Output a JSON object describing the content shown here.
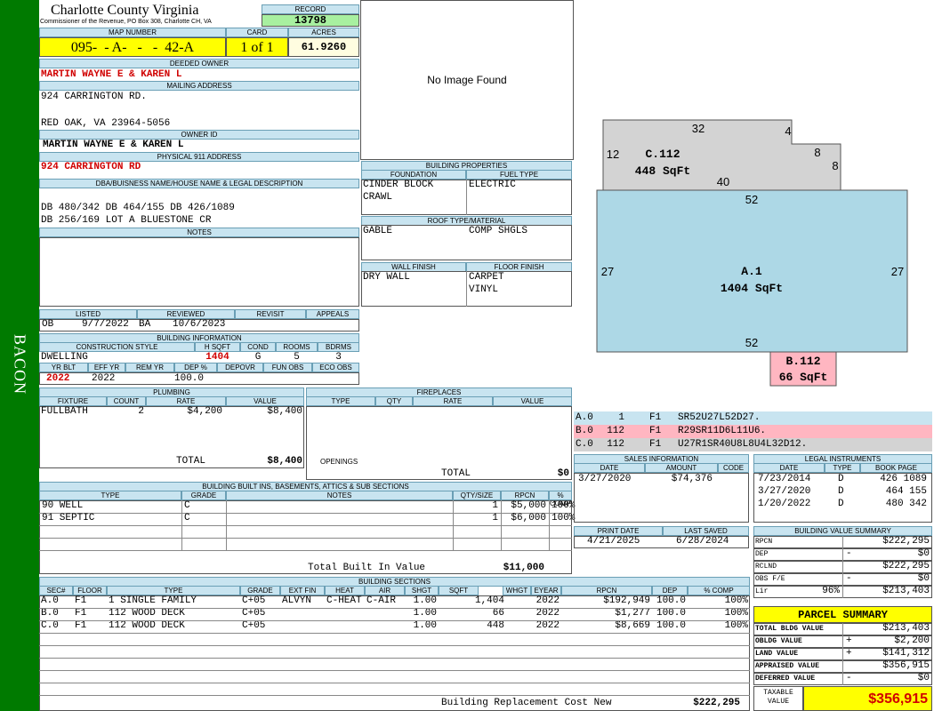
{
  "side": {
    "label": "BACON"
  },
  "header": {
    "county": "Charlotte County Virginia",
    "address": "Commissioner of the Revenue, PO Box 308, Charlotte CH, VA",
    "record_label": "RECORD",
    "record": "13798"
  },
  "map": {
    "label": "MAP NUMBER",
    "value": "095-  - A-   -   -  42-A",
    "card_label": "CARD",
    "card": "1 of 1",
    "acres_label": "ACRES",
    "acres": "61.9260"
  },
  "owner": {
    "deeded_label": "DEEDED OWNER",
    "deeded": "MARTIN WAYNE E & KAREN L",
    "mailing_label": "MAILING ADDRESS",
    "addr1": "924 CARRINGTON RD.",
    "addr2": "RED OAK, VA 23964-5056",
    "ownerid_label": "OWNER ID",
    "ownerid": "MARTIN WAYNE E & KAREN L",
    "phys_label": "PHYSICAL 911 ADDRESS",
    "phys": "924 CARRINGTON RD",
    "dba_label": "DBA/BUISNESS NAME/HOUSE NAME & LEGAL DESCRIPTION",
    "legal1": "DB 480/342 DB 464/155 DB 426/1089",
    "legal2": "DB 256/169 LOT A BLUESTONE CR",
    "notes_label": "NOTES"
  },
  "image": {
    "text": "No Image Found"
  },
  "building_props": {
    "label": "BUILDING PROPERTIES",
    "foundation_label": "FOUNDATION",
    "fuel_label": "FUEL TYPE",
    "foundation1": "CINDER BLOCK",
    "foundation2": "CRAWL",
    "fuel": "ELECTRIC",
    "roof_label": "ROOF TYPE/MATERIAL",
    "roof1": "GABLE",
    "roof2": "COMP SHGLS",
    "wall_label": "WALL FINISH",
    "floor_label": "FLOOR FINISH",
    "wall": "DRY WALL",
    "floor1": "CARPET",
    "floor2": "VINYL"
  },
  "listing": {
    "listed_label": "LISTED",
    "reviewed_label": "REVIEWED",
    "revisit_label": "REVISIT",
    "appeals_label": "APPEALS",
    "listed_by": "OB",
    "listed_date": "9/7/2022",
    "reviewed_by": "BA",
    "reviewed_date": "10/6/2023"
  },
  "building_info": {
    "label": "BUILDING INFORMATION",
    "cs_label": "CONSTRUCTION STYLE",
    "hsqft_label": "H SQFT",
    "cond_label": "COND",
    "rooms_label": "ROOMS",
    "bdrms_label": "BDRMS",
    "style": "DWELLING",
    "hsqft": "1404",
    "cond": "G",
    "rooms": "5",
    "bdrms": "3",
    "yrblt_label": "YR BLT",
    "effyr_label": "EFF YR",
    "remyr_label": "REM YR",
    "dep_label": "DEP %",
    "depovr_label": "DEPOVR",
    "funobs_label": "FUN OBS",
    "ecoobs_label": "ECO OBS",
    "yrblt": "2022",
    "effyr": "2022",
    "dep": "100.0"
  },
  "plumbing": {
    "label": "PLUMBING",
    "cols": [
      "FIXTURE",
      "COUNT",
      "RATE",
      "VALUE"
    ],
    "fixture": "FULLBATH",
    "count": "2",
    "rate": "$4,200",
    "value": "$8,400",
    "total_label": "TOTAL",
    "total": "$8,400"
  },
  "fireplaces": {
    "label": "FIREPLACES",
    "cols": [
      "TYPE",
      "QTY",
      "RATE",
      "VALUE"
    ],
    "openings_label": "OPENINGS",
    "total_label": "TOTAL",
    "total": "$0"
  },
  "builtins": {
    "label": "BUILDING BUILT INS, BASEMENTS, ATTICS & SUB SECTIONS",
    "cols": [
      "TYPE",
      "GRADE",
      "NOTES",
      "QTY/SIZE",
      "RPCN",
      "% COMP"
    ],
    "rows": [
      [
        "90 WELL",
        "C",
        "",
        "1",
        "$5,000",
        "100%"
      ],
      [
        "91 SEPTIC",
        "C",
        "",
        "1",
        "$6,000",
        "100%"
      ]
    ],
    "total_label": "Total Built In Value",
    "total": "$11,000"
  },
  "sections": {
    "label": "BUILDING SECTIONS",
    "cols": [
      "SEC#",
      "FLOOR",
      "TYPE",
      "GRADE",
      "EXT FIN",
      "HEAT",
      "AIR",
      "SHGT",
      "SQFT",
      "WHGT",
      "EYEAR",
      "RPCN",
      "DEP",
      "% COMP"
    ],
    "rows": [
      [
        "A.0",
        "F1",
        "1 SINGLE FAMILY",
        "C+05",
        "ALVYN",
        "C-HEAT",
        "C-AIR",
        "1.00",
        "1,404",
        "",
        "2022",
        "$192,949",
        "100.0",
        "100%"
      ],
      [
        "B.0",
        "F1",
        "112 WOOD DECK",
        "C+05",
        "",
        "",
        "",
        "1.00",
        "66",
        "",
        "2022",
        "$1,277",
        "100.0",
        "100%"
      ],
      [
        "C.0",
        "F1",
        "112 WOOD DECK",
        "C+05",
        "",
        "",
        "",
        "1.00",
        "448",
        "",
        "2022",
        "$8,669",
        "100.0",
        "100%"
      ]
    ],
    "rcn_label": "Building Replacement Cost New",
    "rcn": "$222,295"
  },
  "sketch": {
    "c_label": "C.112",
    "c_area": "448 SqFt",
    "a_label": "A.1",
    "a_area": "1404 SqFt",
    "b_label": "B.112",
    "b_area": "66 SqFt",
    "dims": {
      "c_top": "32",
      "c_notch": "4",
      "c_left": "12",
      "c_step": "8",
      "c_right": "8",
      "c_bottom": "40",
      "a_top": "52",
      "a_left": "27",
      "a_right": "27",
      "a_bottom": "52"
    }
  },
  "traverses": [
    {
      "sec": "A.0",
      "n": "1",
      "f": "F1",
      "path": "SR52U27L52D27."
    },
    {
      "sec": "B.0",
      "n": "112",
      "f": "F1",
      "path": "R29SR11D6L11U6."
    },
    {
      "sec": "C.0",
      "n": "112",
      "f": "F1",
      "path": "U27R1SR40U8L8U4L32D12."
    }
  ],
  "sales": {
    "label": "SALES INFORMATION",
    "cols": [
      "DATE",
      "AMOUNT",
      "CODE"
    ],
    "rows": [
      [
        "3/27/2020",
        "$74,376",
        ""
      ]
    ]
  },
  "legal": {
    "label": "LEGAL INSTRUMENTS",
    "cols": [
      "DATE",
      "TYPE",
      "BOOK PAGE"
    ],
    "rows": [
      [
        "7/23/2014",
        "D",
        "426 1089"
      ],
      [
        "3/27/2020",
        "D",
        "464 155"
      ],
      [
        "1/20/2022",
        "D",
        "480 342"
      ]
    ]
  },
  "dates": {
    "print_label": "PRINT DATE",
    "saved_label": "LAST SAVED",
    "print": "4/21/2025",
    "saved": "6/28/2024"
  },
  "bvs": {
    "label": "BUILDING VALUE SUMMARY",
    "rows": [
      [
        "RPCN",
        "",
        "",
        "$222,295"
      ],
      [
        "DEP",
        "",
        "-",
        "$0"
      ],
      [
        "RCLND",
        "",
        "",
        "$222,295"
      ],
      [
        "OBS F/E",
        "",
        "-",
        "$0"
      ],
      [
        "Lir",
        "96%",
        "",
        "$213,403"
      ]
    ]
  },
  "parcel": {
    "label": "PARCEL SUMMARY",
    "rows": [
      [
        "TOTAL BLDG VALUE",
        "",
        "$213,403"
      ],
      [
        "OBLDG VALUE",
        "+",
        "$2,200"
      ],
      [
        "LAND VALUE",
        "+",
        "$141,312"
      ],
      [
        "APPRAISED VALUE",
        "",
        "$356,915"
      ],
      [
        "DEFERRED VALUE",
        "-",
        "$0"
      ]
    ],
    "taxable_label1": "TAXABLE",
    "taxable_label2": "VALUE",
    "taxable": "$356,915"
  },
  "colors": {
    "green": "#007a00",
    "header_blue": "#c8e4f0",
    "yellow": "#ffff00",
    "light_green": "#a8f0a0",
    "sketch_blue": "#add8e6",
    "sketch_gray": "#d3d3d3",
    "sketch_pink": "#ffb6c1",
    "red": "#d00000"
  }
}
